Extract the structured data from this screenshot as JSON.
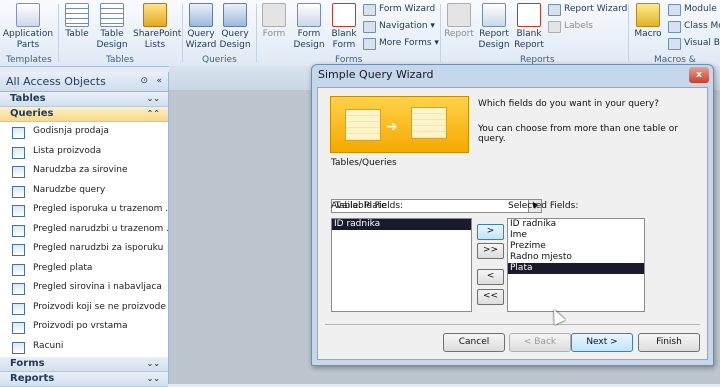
{
  "ribbon": {
    "buttons": [
      {
        "label": "Application\nParts",
        "key": "application_parts"
      },
      {
        "label": "Table",
        "key": "table"
      },
      {
        "label": "Table\nDesign",
        "key": "table_design"
      },
      {
        "label": "SharePoint\nLists",
        "key": "sharepoint_lists"
      },
      {
        "label": "Query\nWizard",
        "key": "query_wizard"
      },
      {
        "label": "Query\nDesign",
        "key": "query_design"
      },
      {
        "label": "Form",
        "key": "form"
      },
      {
        "label": "Form\nDesign",
        "key": "form_design"
      },
      {
        "label": "Blank\nForm",
        "key": "blank_form"
      },
      {
        "label": "Report",
        "key": "report"
      },
      {
        "label": "Report\nDesign",
        "key": "report_design"
      },
      {
        "label": "Blank\nReport",
        "key": "blank_report"
      },
      {
        "label": "Macro",
        "key": "macro"
      }
    ],
    "small": {
      "form_wizard": "Form Wizard",
      "navigation": "Navigation",
      "more_forms": "More Forms",
      "report_wizard": "Report Wizard",
      "labels": "Labels",
      "module": "Module",
      "class_module": "Class Mo",
      "visual_basic": "Visual Ba"
    },
    "groups": {
      "templates": "Templates",
      "tables": "Tables",
      "queries": "Queries",
      "forms": "Forms",
      "reports": "Reports",
      "macros": "Macros & Code"
    }
  },
  "nav": {
    "title": "All Access Objects",
    "sections": {
      "tables": "Tables",
      "queries": "Queries",
      "forms": "Forms",
      "reports": "Reports"
    },
    "queries": [
      "Godisnja prodaja",
      "Lista proizvoda",
      "Narudzba za sirovine",
      "Narudzbe query",
      "Pregled isporuka  u trazenom ...",
      "Pregled narudzbi  u trazenom ...",
      "Pregled narudzbi za isporuku",
      "Pregled plata",
      "Pregled sirovina i nabavljaca",
      "Proizvodi koji se ne proizvode",
      "Proizvodi po vrstama",
      "Racuni"
    ]
  },
  "dialog": {
    "title": "Simple Query Wizard",
    "close": "x",
    "prompt1": "Which fields do you want in your query?",
    "prompt2": "You can choose from more than one table or query.",
    "tables_label": "Tables/Queries",
    "table_value": "Table: Plate",
    "available_label": "Available Fields:",
    "selected_label": "Selected Fields:",
    "available": [
      "ID radnika"
    ],
    "selected": [
      "ID radnika",
      "Ime",
      "Prezime",
      "Radno mjesto",
      "Plata"
    ],
    "move": {
      "one": ">",
      "all": ">>",
      "back": "<",
      "back_all": "<<"
    },
    "buttons": {
      "cancel": "Cancel",
      "back": "< Back",
      "next": "Next >",
      "finish": "Finish"
    }
  },
  "colors": {
    "accent": "#1e395b",
    "selection": "#1a1a2e",
    "banner": "#f5a800"
  }
}
